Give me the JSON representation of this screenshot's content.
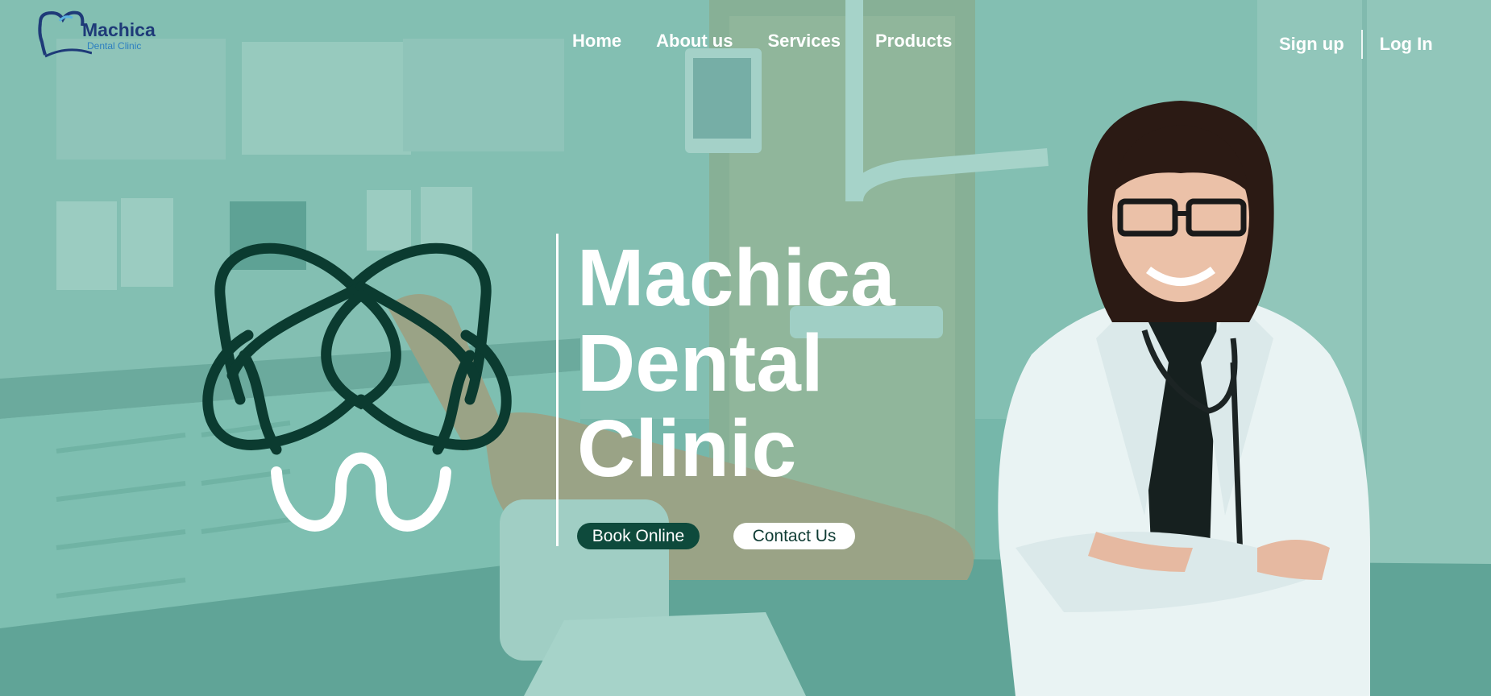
{
  "brand": {
    "name": "Machica",
    "tagline": "Dental Clinic"
  },
  "nav": {
    "items": [
      {
        "label": "Home"
      },
      {
        "label": "About us"
      },
      {
        "label": "Services"
      },
      {
        "label": "Products"
      }
    ]
  },
  "auth": {
    "signup_label": "Sign up",
    "login_label": "Log In"
  },
  "hero": {
    "title_lines": [
      "Machica",
      "Dental",
      "Clinic"
    ],
    "book_label": "Book Online",
    "contact_label": "Contact Us"
  },
  "colors": {
    "overlay_teal": "#6fb3a6",
    "logo_dark_green": "#0b3b30",
    "button_dark": "#0e4a3c",
    "text_white": "#ffffff",
    "brand_blue": "#1e3a78"
  },
  "icons": {
    "brand_logo": "tooth-logo-icon",
    "hero_logo": "tooth-emblem-icon"
  }
}
